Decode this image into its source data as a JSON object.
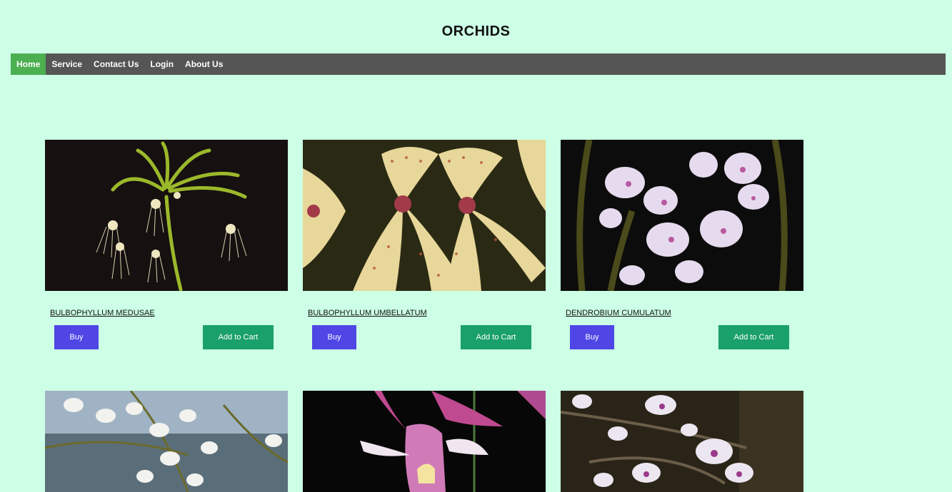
{
  "site": {
    "title": "ORCHIDS"
  },
  "nav": {
    "items": [
      {
        "label": "Home",
        "active": true
      },
      {
        "label": "Service"
      },
      {
        "label": "Contact Us"
      },
      {
        "label": "Login"
      },
      {
        "label": "About Us"
      }
    ]
  },
  "products": [
    {
      "name": "BULBOPHYLLUM MEDUSAE",
      "buy_label": "Buy",
      "cart_label": "Add to Cart"
    },
    {
      "name": "BULBOPHYLLUM UMBELLATUM",
      "buy_label": "Buy",
      "cart_label": "Add to Cart"
    },
    {
      "name": "DENDROBIUM CUMULATUM",
      "buy_label": "Buy",
      "cart_label": "Add to Cart"
    },
    {
      "name": ""
    },
    {
      "name": ""
    },
    {
      "name": ""
    }
  ],
  "colors": {
    "background": "#ccffe5",
    "nav_bg": "#555555",
    "nav_active": "#4caf50",
    "buy_button": "#4f46e5",
    "cart_button": "#1aa06a"
  }
}
